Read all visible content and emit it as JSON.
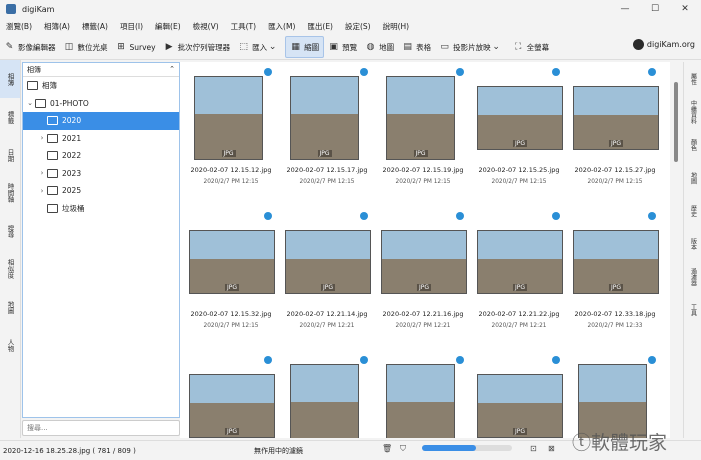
{
  "window": {
    "title": "digiKam",
    "controls": [
      "—",
      "☐",
      "✕"
    ]
  },
  "menu": [
    "瀏覽(B)",
    "相簿(A)",
    "標籤(A)",
    "項目(I)",
    "編輯(E)",
    "檢視(V)",
    "工具(T)",
    "匯入(M)",
    "匯出(E)",
    "設定(S)",
    "說明(H)"
  ],
  "toolbar": {
    "image_editor": "影像編輯器",
    "light_table": "數位光桌",
    "survey": "Survey",
    "batch_queue": "批次佇列管理器",
    "import": "匯入",
    "thumbnails": "縮圖",
    "preview": "預覽",
    "map": "地圖",
    "table": "表格",
    "slideshow": "投影片放映",
    "fullscreen": "全螢幕"
  },
  "brand": "digiKam.org",
  "left_tabs": [
    "相簿",
    "標籤",
    "日期",
    "時間軸",
    "搜尋",
    "相似度",
    "地圖",
    "人物"
  ],
  "albums_panel": {
    "header": "相簿",
    "root": "相簿",
    "items": [
      {
        "label": "01-PHOTO",
        "arrow": "⌄",
        "level": 1
      },
      {
        "label": "2020",
        "arrow": "",
        "level": 2,
        "selected": true
      },
      {
        "label": "2021",
        "arrow": "›",
        "level": 2
      },
      {
        "label": "2022",
        "arrow": "",
        "level": 2
      },
      {
        "label": "2023",
        "arrow": "›",
        "level": 2
      },
      {
        "label": "2025",
        "arrow": "›",
        "level": 2
      },
      {
        "label": "垃圾桶",
        "arrow": "",
        "level": 2
      }
    ],
    "search_placeholder": "搜尋..."
  },
  "thumbnails": [
    {
      "name": "2020-02-07 12.15.12.jpg",
      "date": "2020/2/7 PM 12:15",
      "badge": "JPG",
      "orient": "port"
    },
    {
      "name": "2020-02-07 12.15.17.jpg",
      "date": "2020/2/7 PM 12:15",
      "badge": "JPG",
      "orient": "port"
    },
    {
      "name": "2020-02-07 12.15.19.jpg",
      "date": "2020/2/7 PM 12:15",
      "badge": "JPG",
      "orient": "port"
    },
    {
      "name": "2020-02-07 12.15.25.jpg",
      "date": "2020/2/7 PM 12:15",
      "badge": "JPG",
      "orient": "land"
    },
    {
      "name": "2020-02-07 12.15.27.jpg",
      "date": "2020/2/7 PM 12:15",
      "badge": "JPG",
      "orient": "land"
    },
    {
      "name": "2020-02-07 12.15.32.jpg",
      "date": "2020/2/7 PM 12:15",
      "badge": "JPG",
      "orient": "land"
    },
    {
      "name": "2020-02-07 12.21.14.jpg",
      "date": "2020/2/7 PM 12:21",
      "badge": "JPG",
      "orient": "land"
    },
    {
      "name": "2020-02-07 12.21.16.jpg",
      "date": "2020/2/7 PM 12:21",
      "badge": "JPG",
      "orient": "land"
    },
    {
      "name": "2020-02-07 12.21.22.jpg",
      "date": "2020/2/7 PM 12:21",
      "badge": "JPG",
      "orient": "land"
    },
    {
      "name": "2020-02-07 12.33.18.jpg",
      "date": "2020/2/7 PM 12:33",
      "badge": "JPG",
      "orient": "land"
    },
    {
      "name": "",
      "date": "",
      "badge": "JPG",
      "orient": "land"
    },
    {
      "name": "",
      "date": "",
      "badge": "JPG",
      "orient": "port"
    },
    {
      "name": "",
      "date": "",
      "badge": "JPG",
      "orient": "port"
    },
    {
      "name": "",
      "date": "",
      "badge": "JPG",
      "orient": "land"
    },
    {
      "name": "",
      "date": "",
      "badge": "JPG",
      "orient": "port"
    }
  ],
  "right_tabs": [
    "屬性",
    "中繼資料",
    "顏色",
    "地圖",
    "歷史",
    "版本",
    "過濾器",
    "工具"
  ],
  "status": {
    "left": "2020-12-16 18.25.28.jpg ( 781 / 809 )",
    "center": "無作用中的濾鏡",
    "zoom_fraction": 0.6
  },
  "watermark": "ⓣ軟體玩家"
}
